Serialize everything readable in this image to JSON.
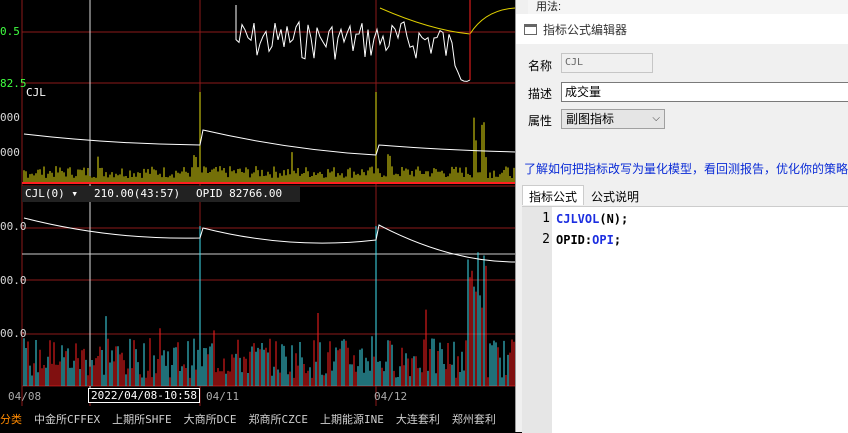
{
  "chart": {
    "y_labels": {
      "main_top": "0.5",
      "main_bottom": "82.5",
      "cjl_upper": "000",
      "cjl_lower": "000",
      "sub_upper": "00.0",
      "sub_mid": "00.0",
      "sub_lower": "00.0"
    },
    "panel1_label": "CJL",
    "panel2_label": "CJL(0)",
    "panel2_value": "210.00(43:57)",
    "panel2_opid": "OPID 82766.00",
    "x_labels": [
      "04/08",
      "04/11",
      "04/12"
    ],
    "cursor_time": "2022/04/08-10:58",
    "colors": {
      "up": "#ff2020",
      "down": "#40e0f0",
      "volume": "#e8e010",
      "grid": "#8b1a1a",
      "line": "#ffffff"
    }
  },
  "bottom_tabs": [
    "分类",
    "中金所CFFEX",
    "上期所SHFE",
    "大商所DCE",
    "郑商所CZCE",
    "上期能源INE",
    "大连套利",
    "郑州套利"
  ],
  "editor": {
    "usage_label": "用法:",
    "window_title": "指标公式编辑器",
    "name_label": "名称",
    "name_value": "CJL",
    "desc_label": "描述",
    "desc_value": "成交量",
    "attr_label": "属性",
    "attr_value": "副图指标",
    "link_text": "了解如何把指标改写为量化模型，看回测报告，优化你的策略",
    "tabs": [
      "指标公式",
      "公式说明"
    ],
    "code_lines": [
      {
        "num": "1",
        "kw": "CJLVOL",
        "rest": "(N);"
      },
      {
        "num": "2",
        "pre": "OPID:",
        "kw": "OPI",
        "rest": ";"
      }
    ]
  }
}
